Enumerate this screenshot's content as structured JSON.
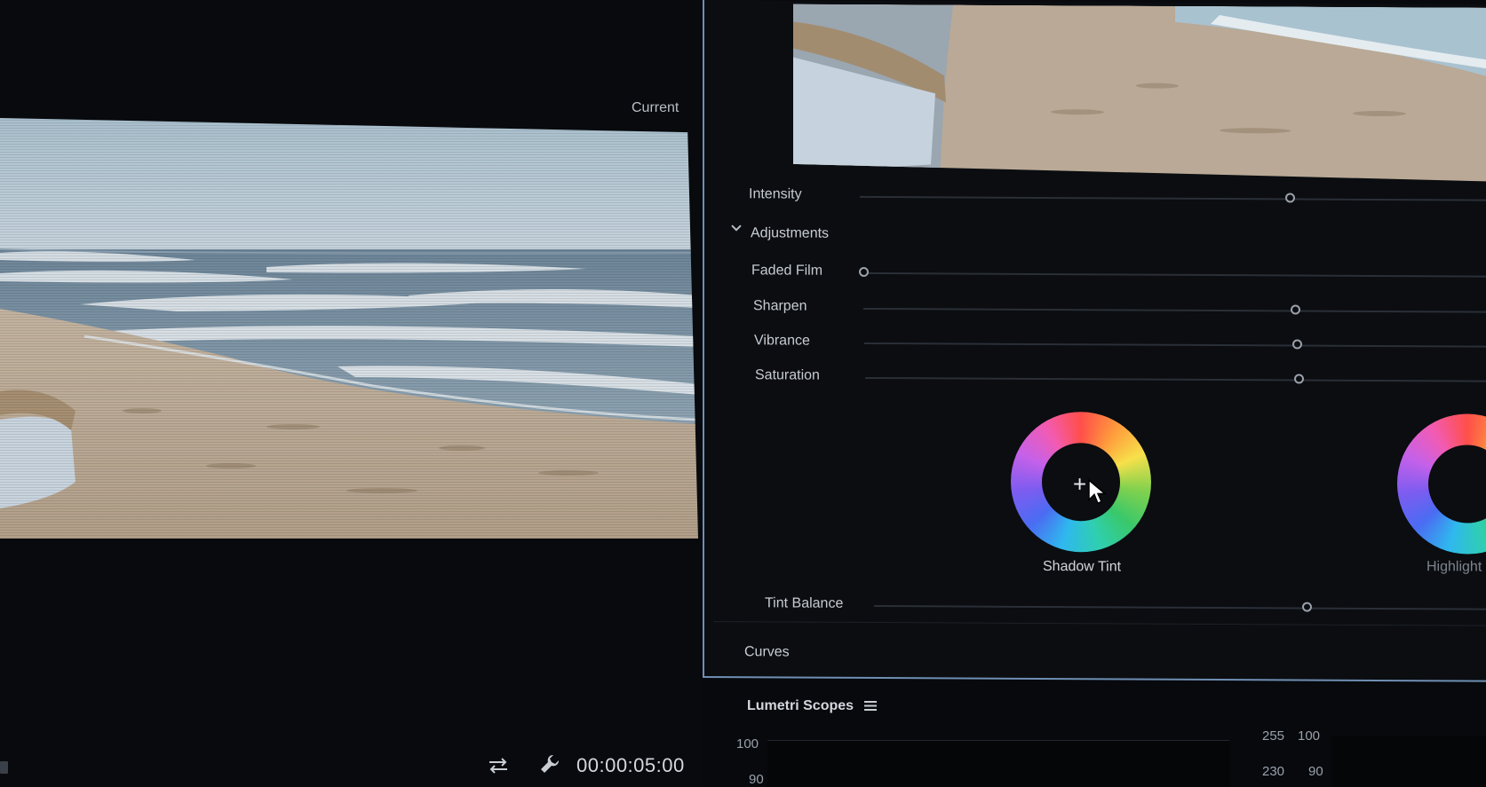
{
  "program_monitor": {
    "compare_label": "Current",
    "timecode": "00:00:05:00",
    "icons": [
      "swap-icon",
      "wrench-icon"
    ]
  },
  "lumetri_color": {
    "intensity": {
      "label": "Intensity",
      "value": 0.64
    },
    "adjustments": {
      "header": "Adjustments",
      "sliders": [
        {
          "label": "Faded Film",
          "value": 0.0
        },
        {
          "label": "Sharpen",
          "value": 0.64
        },
        {
          "label": "Vibrance",
          "value": 0.64
        },
        {
          "label": "Saturation",
          "value": 0.64
        }
      ],
      "wheels": {
        "shadow": "Shadow Tint",
        "highlight": "Highlight"
      },
      "tint_balance": {
        "label": "Tint Balance",
        "value": 0.64
      }
    },
    "curves_header": "Curves",
    "colors": {
      "panel_border": "#6f8fb3",
      "panel_bg": "#0b0d11"
    }
  },
  "lumetri_scopes": {
    "title": "Lumetri Scopes",
    "left_scale": [
      "100",
      "90"
    ],
    "right_scale_8bit": [
      "255",
      "230"
    ],
    "right_scale_pct": [
      "100",
      "90"
    ]
  }
}
